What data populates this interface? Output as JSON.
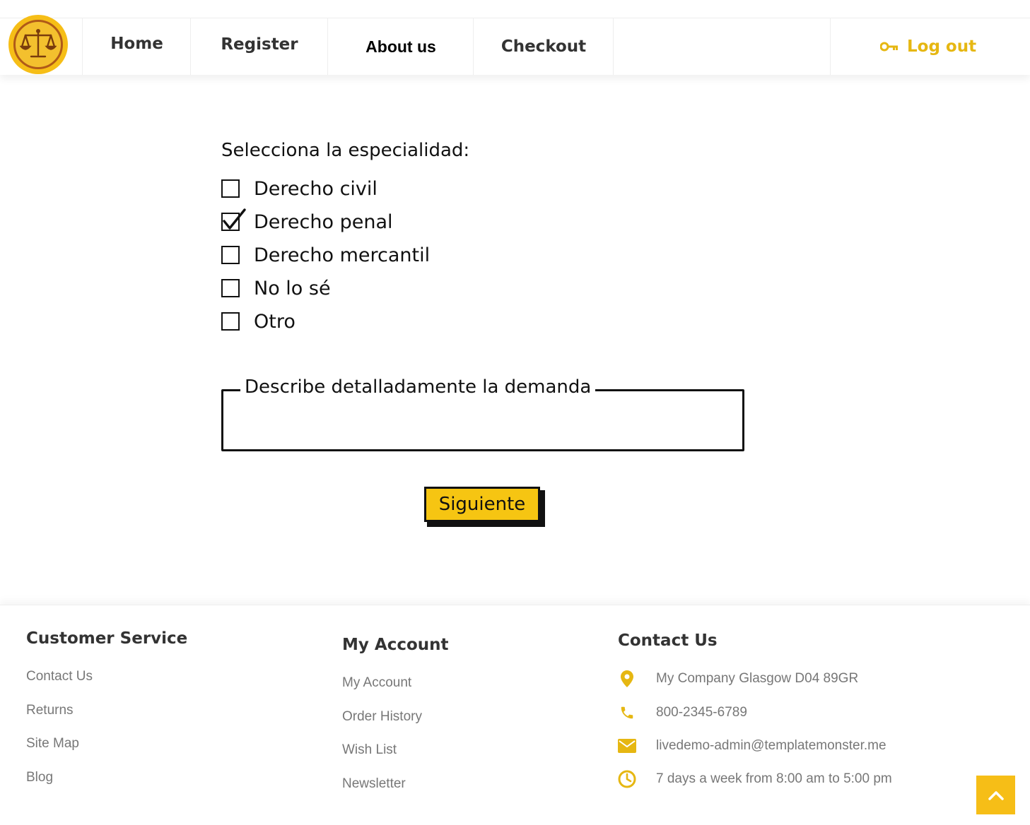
{
  "brand": {
    "logo_icon": "scales-of-justice-icon"
  },
  "nav": {
    "items": [
      "Home",
      "Register",
      "About us",
      "Checkout"
    ],
    "logout": {
      "label": "Log out",
      "icon": "key-icon"
    }
  },
  "form": {
    "title": "Selecciona la especialidad:",
    "options": [
      {
        "label": "Derecho civil",
        "checked": false
      },
      {
        "label": "Derecho penal",
        "checked": true
      },
      {
        "label": "Derecho mercantil",
        "checked": false
      },
      {
        "label": "No lo sé",
        "checked": false
      },
      {
        "label": "Otro",
        "checked": false
      }
    ],
    "description_label": "Describe detalladamente la demanda",
    "description_value": "",
    "submit_label": "Siguiente"
  },
  "footer": {
    "customer_service": {
      "title": "Customer Service",
      "links": [
        "Contact Us",
        "Returns",
        "Site Map",
        "Blog"
      ]
    },
    "my_account": {
      "title": "My Account",
      "links": [
        "My Account",
        "Order History",
        "Wish List",
        "Newsletter"
      ]
    },
    "contact": {
      "title": "Contact Us",
      "address": "My Company Glasgow D04 89GR",
      "phone": "800-2345-6789",
      "email": "livedemo-admin@templatemonster.me",
      "hours": "7 days a week from 8:00 am to 5:00 pm",
      "icons": [
        "map-pin-icon",
        "phone-icon",
        "mail-icon",
        "clock-icon"
      ]
    }
  },
  "colors": {
    "accent": "#f6be17",
    "text": "#333333",
    "muted": "#777777"
  },
  "scroll_top_icon": "chevron-up-icon"
}
